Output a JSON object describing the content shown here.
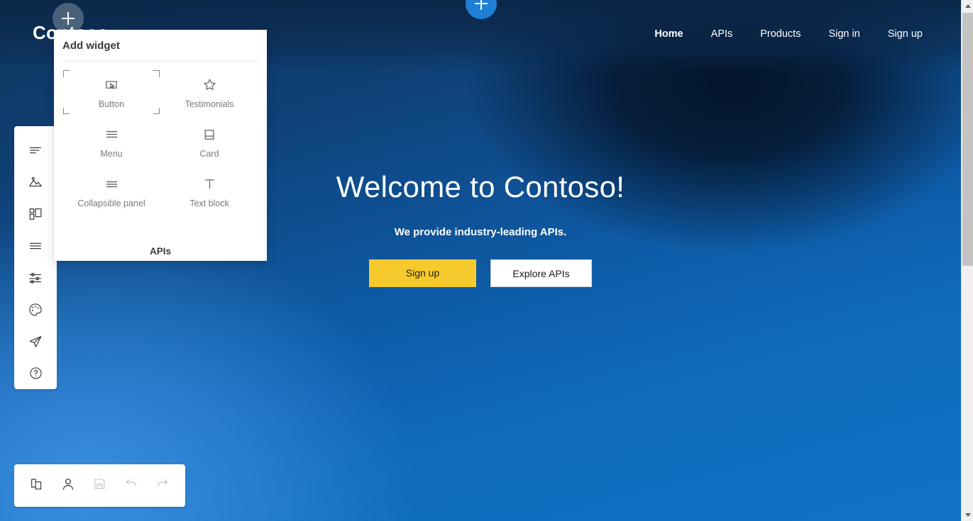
{
  "site": {
    "logo": "Contoso",
    "nav": [
      {
        "label": "Home",
        "active": true
      },
      {
        "label": "APIs",
        "active": false
      },
      {
        "label": "Products",
        "active": false
      },
      {
        "label": "Sign in",
        "active": false
      },
      {
        "label": "Sign up",
        "active": false
      }
    ],
    "hero": {
      "title": "Welcome to Contoso!",
      "subtitle": "We provide industry-leading APIs.",
      "primary_button": "Sign up",
      "secondary_button": "Explore APIs"
    },
    "colors": {
      "header_navy": "#0d3561",
      "hero_blue": "#0e5aa5",
      "primary_yellow": "#f6ca2d",
      "accent_blue": "#1e7fd4"
    }
  },
  "editor": {
    "insert_buttons": [
      {
        "name": "add-section-top",
        "glyph": "+"
      },
      {
        "name": "add-section-left",
        "glyph": "+"
      }
    ],
    "rail": [
      {
        "icon": "text-lines-icon",
        "label": "Pages"
      },
      {
        "icon": "image-icon",
        "label": "Media"
      },
      {
        "icon": "layout-blocks-icon",
        "label": "Layouts"
      },
      {
        "icon": "list-lines-icon",
        "label": "Navigation"
      },
      {
        "icon": "settings-sliders-icon",
        "label": "Settings"
      },
      {
        "icon": "palette-icon",
        "label": "Styles"
      },
      {
        "icon": "paper-plane-icon",
        "label": "Publish"
      },
      {
        "icon": "help-circle-icon",
        "label": "Help"
      }
    ],
    "bottom_toolbar": [
      {
        "icon": "copy-pages-icon",
        "label": "Pages",
        "disabled": false
      },
      {
        "icon": "user-icon",
        "label": "Profile",
        "disabled": false
      },
      {
        "icon": "save-icon",
        "label": "Save",
        "disabled": true
      },
      {
        "icon": "undo-icon",
        "label": "Undo",
        "disabled": true
      },
      {
        "icon": "redo-icon",
        "label": "Redo",
        "disabled": true
      }
    ]
  },
  "flyout": {
    "title": "Add widget",
    "widgets": [
      {
        "label": "Button",
        "icon": "button-cursor-icon",
        "selected": true
      },
      {
        "label": "Testimonials",
        "icon": "star-icon",
        "selected": false
      },
      {
        "label": "Menu",
        "icon": "hamburger-icon",
        "selected": false
      },
      {
        "label": "Card",
        "icon": "card-icon",
        "selected": false
      },
      {
        "label": "Collapsible panel",
        "icon": "collapsible-icon",
        "selected": false
      },
      {
        "label": "Text block",
        "icon": "text-t-icon",
        "selected": false
      }
    ],
    "group_heading": "APIs"
  }
}
